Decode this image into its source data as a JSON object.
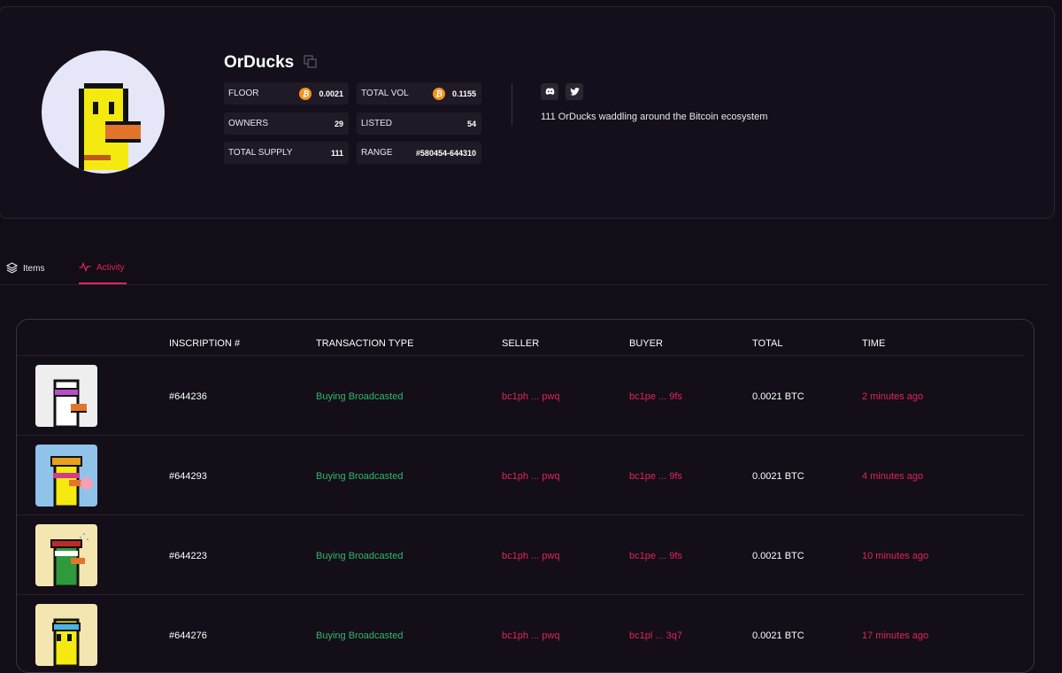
{
  "collection": {
    "name": "OrDucks",
    "description": "111 OrDucks waddling around the Bitcoin ecosystem"
  },
  "stats": {
    "floor": {
      "label": "FLOOR",
      "value": "0.0021",
      "icon": "bitcoin-icon"
    },
    "total_vol": {
      "label": "TOTAL VOL",
      "value": "0.1155",
      "icon": "bitcoin-icon"
    },
    "owners": {
      "label": "OWNERS",
      "value": "29"
    },
    "listed": {
      "label": "LISTED",
      "value": "54"
    },
    "total_supply": {
      "label": "TOTAL SUPPLY",
      "value": "111"
    },
    "range": {
      "label": "RANGE",
      "value": "#580454-644310"
    }
  },
  "social": [
    "discord-icon",
    "twitter-icon"
  ],
  "tabs": [
    {
      "label": "Items",
      "icon": "layers-icon",
      "active": false
    },
    {
      "label": "Activity",
      "icon": "activity-icon",
      "active": true
    }
  ],
  "table": {
    "headers": [
      "INSCRIPTION #",
      "TRANSACTION TYPE",
      "SELLER",
      "BUYER",
      "TOTAL",
      "TIME"
    ],
    "rows": [
      {
        "inscription": "#644236",
        "type": "Buying Broadcasted",
        "seller": "bc1ph ... pwq",
        "buyer": "bc1pe ... 9fs",
        "total": "0.0021 BTC",
        "time": "2 minutes ago",
        "thumb_bg": "#eeeeee"
      },
      {
        "inscription": "#644293",
        "type": "Buying Broadcasted",
        "seller": "bc1ph ... pwq",
        "buyer": "bc1pe ... 9fs",
        "total": "0.0021 BTC",
        "time": "4 minutes ago",
        "thumb_bg": "#8fc3ea"
      },
      {
        "inscription": "#644223",
        "type": "Buying Broadcasted",
        "seller": "bc1ph ... pwq",
        "buyer": "bc1pe ... 9fs",
        "total": "0.0021 BTC",
        "time": "10 minutes ago",
        "thumb_bg": "#f4e6b0"
      },
      {
        "inscription": "#644276",
        "type": "Buying Broadcasted",
        "seller": "bc1ph ... pwq",
        "buyer": "bc1pl ... 3q7",
        "total": "0.0021 BTC",
        "time": "17 minutes ago",
        "thumb_bg": "#f4e6b0"
      }
    ]
  },
  "colors": {
    "accent": "#e0245e",
    "success": "#2fb86b",
    "bitcoin": "#f7931a"
  }
}
